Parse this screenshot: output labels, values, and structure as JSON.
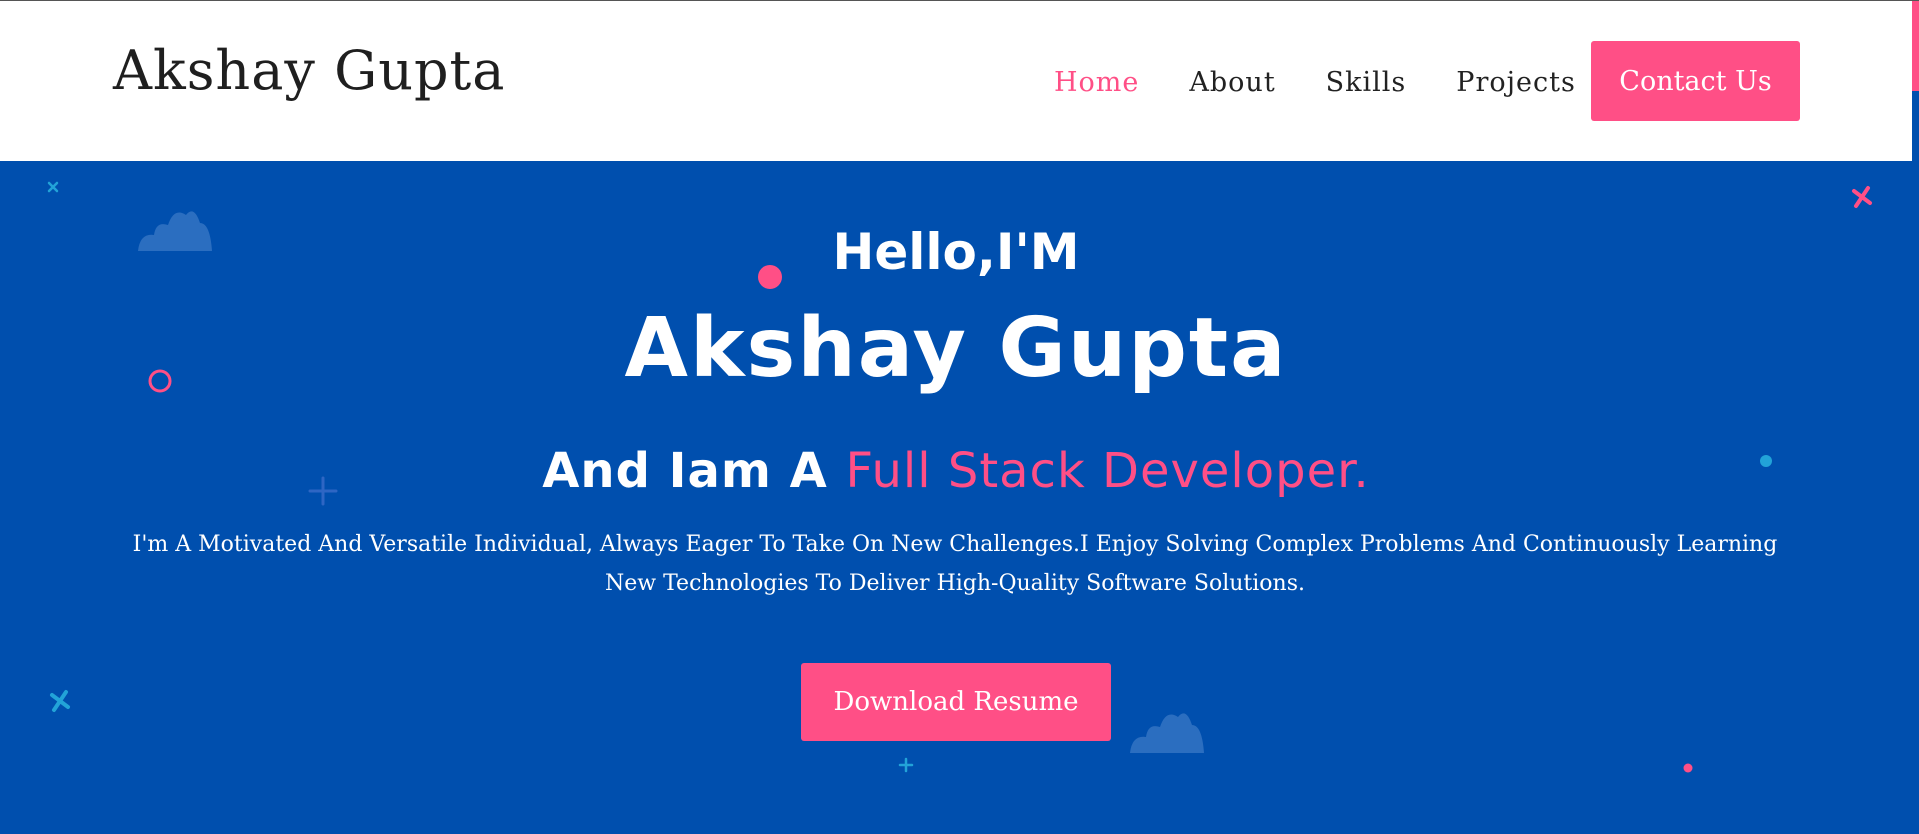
{
  "header": {
    "brand": "Akshay Gupta",
    "nav": [
      "Home",
      "About",
      "Skills",
      "Projects"
    ],
    "active_nav": "Home",
    "contact_label": "Contact Us"
  },
  "hero": {
    "greeting": "Hello,I'M",
    "name": "Akshay Gupta",
    "role_prefix": "And Iam A ",
    "role_highlight": "Full Stack Developer.",
    "description": "I'm A Motivated And Versatile Individual, Always Eager To Take On New Challenges.I Enjoy Solving Complex Problems And Continuously Learning New Technologies To Deliver High-Quality Software Solutions.",
    "resume_label": "Download Resume"
  },
  "colors": {
    "accent": "#ff4f86",
    "hero_bg": "#004fae",
    "text_dark": "#222222"
  },
  "icons": [
    "cloud-icon",
    "circle-dot-icon",
    "ring-icon",
    "plus-icon",
    "cross-icon"
  ]
}
